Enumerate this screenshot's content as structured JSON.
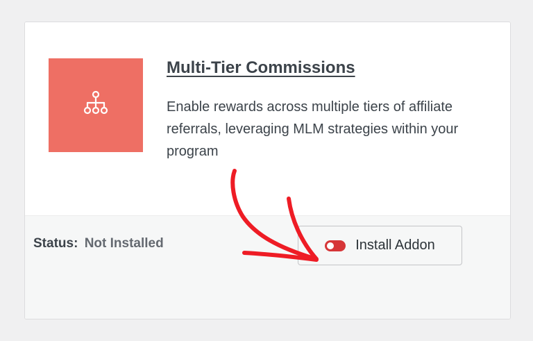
{
  "addon": {
    "title": "Multi-Tier Commissions",
    "description": "Enable rewards across multiple tiers of affiliate referrals, leveraging MLM strategies within your program",
    "icon": "hierarchy-icon",
    "tile_color": "#ee6f64"
  },
  "status": {
    "label": "Status:",
    "value": "Not Installed"
  },
  "install_button": {
    "label": "Install Addon",
    "icon": "toggle-off-icon",
    "toggle_color": "#d63638"
  },
  "annotation": {
    "arrow_color": "#ee1c25"
  }
}
